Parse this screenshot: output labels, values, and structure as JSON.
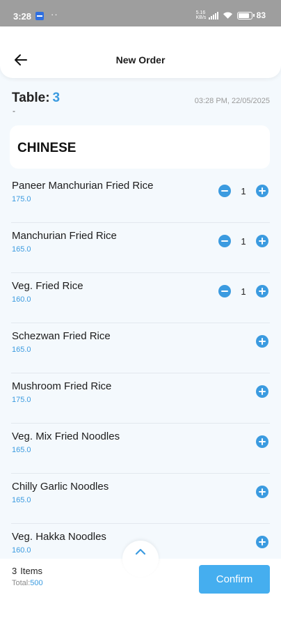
{
  "status_bar": {
    "time": "3:28",
    "dots": "··",
    "network": "5.16 KB/s",
    "battery_percent": "83"
  },
  "header": {
    "title": "New Order",
    "back_icon": "arrow-left-icon"
  },
  "table": {
    "label": "Table:",
    "number": "3",
    "dash": "-",
    "datetime": "03:28 PM, 22/05/2025"
  },
  "category": {
    "name": "CHINESE"
  },
  "items": [
    {
      "name": "Paneer Manchurian Fried Rice",
      "price": "175.0",
      "qty": "1"
    },
    {
      "name": "Manchurian Fried Rice",
      "price": "165.0",
      "qty": "1"
    },
    {
      "name": "Veg. Fried Rice",
      "price": "160.0",
      "qty": "1"
    },
    {
      "name": "Schezwan Fried Rice",
      "price": "165.0",
      "qty": null
    },
    {
      "name": "Mushroom Fried Rice",
      "price": "175.0",
      "qty": null
    },
    {
      "name": "Veg. Mix Fried Noodles",
      "price": "165.0",
      "qty": null
    },
    {
      "name": "Chilly Garlic Noodles",
      "price": "165.0",
      "qty": null
    },
    {
      "name": "Veg. Hakka Noodles",
      "price": "160.0",
      "qty": null
    }
  ],
  "footer": {
    "count": "3",
    "items_label": "Items",
    "total_label": "Total:",
    "total_value": "500",
    "confirm_label": "Confirm"
  },
  "colors": {
    "accent": "#3b9be0",
    "confirm": "#45aeef"
  }
}
